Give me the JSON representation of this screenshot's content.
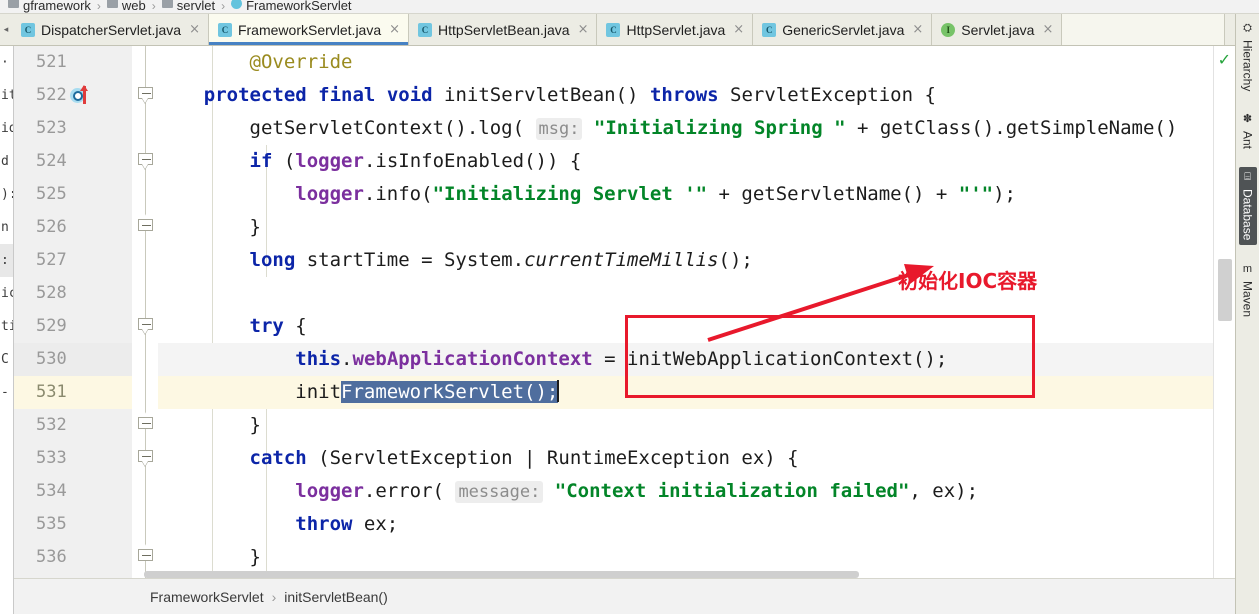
{
  "top_breadcrumb": {
    "items": [
      {
        "label": "gframework",
        "icon": "folder-icon"
      },
      {
        "label": "web",
        "icon": "folder-icon"
      },
      {
        "label": "servlet",
        "icon": "folder-icon"
      },
      {
        "label": "FrameworkServlet",
        "icon": "class-icon"
      }
    ],
    "separator": "›"
  },
  "tabs": {
    "scroll_left": "◂",
    "close_glyph": "×",
    "items": [
      {
        "label": "DispatcherServlet.java",
        "icon": "java-class-icon",
        "icon_letter": "C",
        "active": false
      },
      {
        "label": "FrameworkServlet.java",
        "icon": "java-class-icon",
        "icon_letter": "C",
        "active": true
      },
      {
        "label": "HttpServletBean.java",
        "icon": "java-class-icon",
        "icon_letter": "C",
        "active": false
      },
      {
        "label": "HttpServlet.java",
        "icon": "java-class-icon",
        "icon_letter": "C",
        "active": false
      },
      {
        "label": "GenericServlet.java",
        "icon": "java-class-icon",
        "icon_letter": "C",
        "active": false
      },
      {
        "label": "Servlet.java",
        "icon": "java-interface-icon",
        "icon_letter": "I",
        "active": false
      }
    ],
    "right_button_icon": "structure-icon"
  },
  "right_tool_window": {
    "items": [
      {
        "label": "Hierarchy",
        "icon": "hierarchy-icon",
        "glyph": "⛭",
        "selected": false
      },
      {
        "label": "Ant",
        "icon": "ant-icon",
        "glyph": "✽",
        "selected": false
      },
      {
        "label": "Database",
        "icon": "database-icon",
        "glyph": "⌸",
        "selected": true
      },
      {
        "label": "Maven",
        "icon": "maven-icon",
        "glyph": "m",
        "selected": false
      }
    ]
  },
  "left_strip": {
    "rows": [
      "",
      "",
      "·",
      "it",
      "",
      "id",
      "d",
      "):",
      "n",
      ":",
      "ic",
      "ti",
      "C",
      "-"
    ]
  },
  "editor": {
    "first_line": 521,
    "current_line": 531,
    "inspection_status_icon": "checkmark-icon",
    "lines": [
      {
        "number": "521",
        "fold": null,
        "marker": null,
        "tokens": [
          {
            "t": "        ",
            "c": "plain"
          },
          {
            "t": "@Override",
            "c": "ann"
          }
        ]
      },
      {
        "number": "522",
        "fold": "collapse",
        "marker": "overriding-method-icon",
        "tokens": [
          {
            "t": "    ",
            "c": "plain"
          },
          {
            "t": "protected",
            "c": "kw"
          },
          {
            "t": " ",
            "c": "plain"
          },
          {
            "t": "final",
            "c": "kw"
          },
          {
            "t": " ",
            "c": "plain"
          },
          {
            "t": "void",
            "c": "kw"
          },
          {
            "t": " initServletBean() ",
            "c": "plain"
          },
          {
            "t": "throws",
            "c": "kw"
          },
          {
            "t": " ServletException {",
            "c": "plain"
          }
        ]
      },
      {
        "number": "523",
        "fold": null,
        "marker": null,
        "tokens": [
          {
            "t": "        getServletContext().log( ",
            "c": "plain"
          },
          {
            "t": "msg:",
            "c": "hint"
          },
          {
            "t": " ",
            "c": "plain"
          },
          {
            "t": "\"Initializing Spring \"",
            "c": "str"
          },
          {
            "t": " + getClass().getSimpleName()",
            "c": "plain"
          }
        ]
      },
      {
        "number": "524",
        "fold": "collapse",
        "marker": null,
        "tokens": [
          {
            "t": "        ",
            "c": "plain"
          },
          {
            "t": "if",
            "c": "kw"
          },
          {
            "t": " (",
            "c": "plain"
          },
          {
            "t": "logger",
            "c": "fld"
          },
          {
            "t": ".isInfoEnabled()) {",
            "c": "plain"
          }
        ]
      },
      {
        "number": "525",
        "fold": null,
        "marker": null,
        "tokens": [
          {
            "t": "            ",
            "c": "plain"
          },
          {
            "t": "logger",
            "c": "fld"
          },
          {
            "t": ".info(",
            "c": "plain"
          },
          {
            "t": "\"Initializing Servlet '\"",
            "c": "str"
          },
          {
            "t": " + getServletName() + ",
            "c": "plain"
          },
          {
            "t": "\"'\"",
            "c": "str"
          },
          {
            "t": ");",
            "c": "plain"
          }
        ]
      },
      {
        "number": "526",
        "fold": "expand",
        "marker": null,
        "tokens": [
          {
            "t": "        }",
            "c": "plain"
          }
        ]
      },
      {
        "number": "527",
        "fold": null,
        "marker": null,
        "tokens": [
          {
            "t": "        ",
            "c": "plain"
          },
          {
            "t": "long",
            "c": "kw"
          },
          {
            "t": " startTime = System.",
            "c": "plain"
          },
          {
            "t": "currentTimeMillis",
            "c": "sta"
          },
          {
            "t": "();",
            "c": "plain"
          }
        ]
      },
      {
        "number": "528",
        "fold": null,
        "marker": null,
        "tokens": []
      },
      {
        "number": "529",
        "fold": "collapse",
        "marker": null,
        "tokens": [
          {
            "t": "        ",
            "c": "plain"
          },
          {
            "t": "try",
            "c": "kw"
          },
          {
            "t": " {",
            "c": "plain"
          }
        ]
      },
      {
        "number": "530",
        "fold": null,
        "marker": null,
        "prev": true,
        "tokens": [
          {
            "t": "            ",
            "c": "plain"
          },
          {
            "t": "this",
            "c": "kw"
          },
          {
            "t": ".",
            "c": "plain"
          },
          {
            "t": "webApplicationContext",
            "c": "fld"
          },
          {
            "t": " = initWebApplicationContext();",
            "c": "plain"
          }
        ]
      },
      {
        "number": "531",
        "fold": null,
        "marker": null,
        "current": true,
        "tokens": [
          {
            "t": "            init",
            "c": "plain"
          },
          {
            "t": "FrameworkServlet();",
            "c": "sel"
          },
          {
            "t": "",
            "c": "caret"
          }
        ]
      },
      {
        "number": "532",
        "fold": "expand",
        "marker": null,
        "tokens": [
          {
            "t": "        }",
            "c": "plain"
          }
        ]
      },
      {
        "number": "533",
        "fold": "collapse",
        "marker": null,
        "tokens": [
          {
            "t": "        ",
            "c": "plain"
          },
          {
            "t": "catch",
            "c": "kw"
          },
          {
            "t": " (ServletException | RuntimeException ex) {",
            "c": "plain"
          }
        ]
      },
      {
        "number": "534",
        "fold": null,
        "marker": null,
        "tokens": [
          {
            "t": "            ",
            "c": "plain"
          },
          {
            "t": "logger",
            "c": "fld"
          },
          {
            "t": ".error( ",
            "c": "plain"
          },
          {
            "t": "message:",
            "c": "hint"
          },
          {
            "t": " ",
            "c": "plain"
          },
          {
            "t": "\"Context initialization failed\"",
            "c": "str"
          },
          {
            "t": ", ex);",
            "c": "plain"
          }
        ]
      },
      {
        "number": "535",
        "fold": null,
        "marker": null,
        "tokens": [
          {
            "t": "            ",
            "c": "plain"
          },
          {
            "t": "throw",
            "c": "kw"
          },
          {
            "t": " ex;",
            "c": "plain"
          }
        ]
      },
      {
        "number": "536",
        "fold": "expand",
        "marker": null,
        "tokens": [
          {
            "t": "        }",
            "c": "plain"
          }
        ]
      }
    ]
  },
  "annotation": {
    "text": "初始化IOC容器",
    "color": "#e8192c",
    "box_target_line": "530"
  },
  "bottom_breadcrumb": {
    "items": [
      "FrameworkServlet",
      "initServletBean()"
    ],
    "separator": "›"
  }
}
